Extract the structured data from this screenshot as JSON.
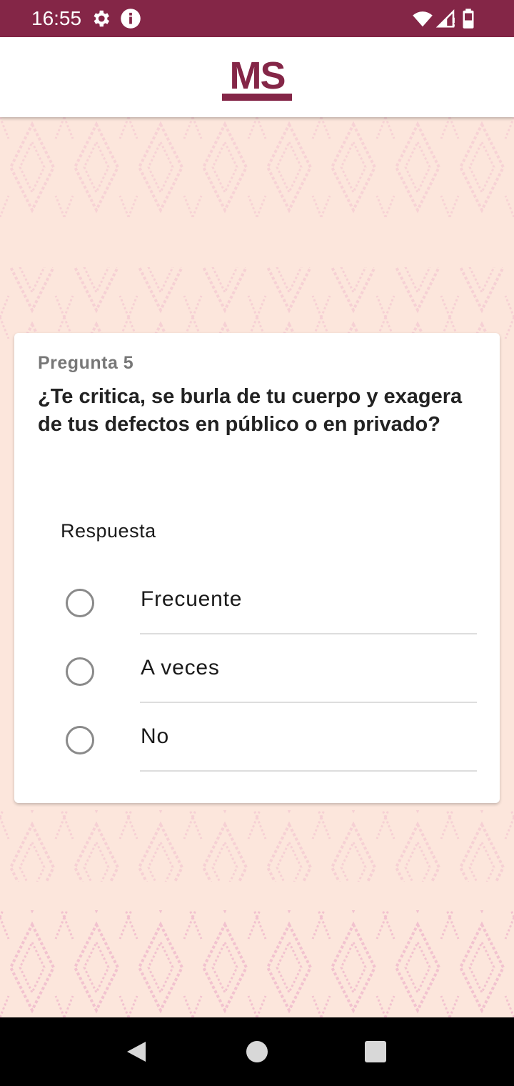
{
  "status_bar": {
    "time": "16:55",
    "icons": [
      "gear-icon",
      "info-icon",
      "wifi-icon",
      "signal-icon",
      "battery-icon"
    ],
    "background": "#842647"
  },
  "header": {
    "logo_text": "MS",
    "logo_color": "#842647"
  },
  "question": {
    "number_label": "Pregunta 5",
    "text": "¿Te critica, se burla de tu cuerpo y exagera de tus defectos en público o en privado?"
  },
  "answer": {
    "label": "Respuesta",
    "options": [
      {
        "label": "Frecuente",
        "selected": false
      },
      {
        "label": "A veces",
        "selected": false
      },
      {
        "label": "No",
        "selected": false
      }
    ]
  },
  "nav_bar": {
    "buttons": [
      "back-icon",
      "home-icon",
      "recents-icon"
    ]
  },
  "colors": {
    "brand": "#842647",
    "background": "#fce6dc",
    "pattern": "#f5b8c8"
  }
}
